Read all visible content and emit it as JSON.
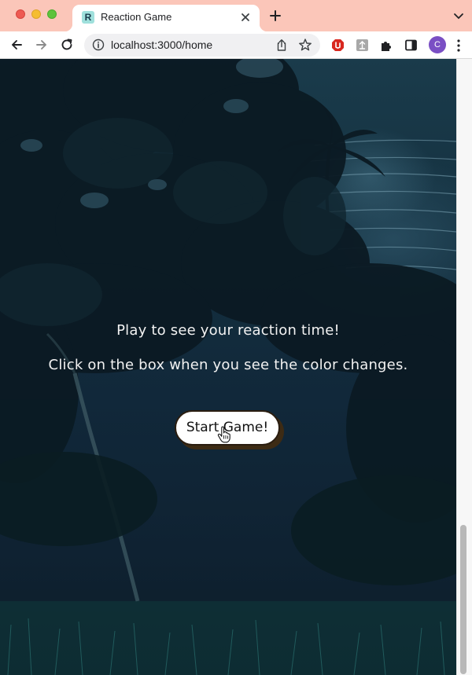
{
  "browser": {
    "tab_title": "Reaction Game",
    "favicon_letter": "R",
    "url": "localhost:3000/home",
    "profile_initial": "C",
    "icons": [
      "back-icon",
      "forward-icon",
      "reload-icon",
      "info-icon",
      "share-icon",
      "star-icon",
      "extension-red-icon",
      "extension-gray-icon",
      "puzzle-icon",
      "sidepanel-icon",
      "more-icon"
    ],
    "tabbar_color": "#fbc6b9"
  },
  "page": {
    "tagline_1": "Play to see your reaction time!",
    "tagline_2": "Click on the box when you see the color changes.",
    "start_button": "Start Game!"
  }
}
